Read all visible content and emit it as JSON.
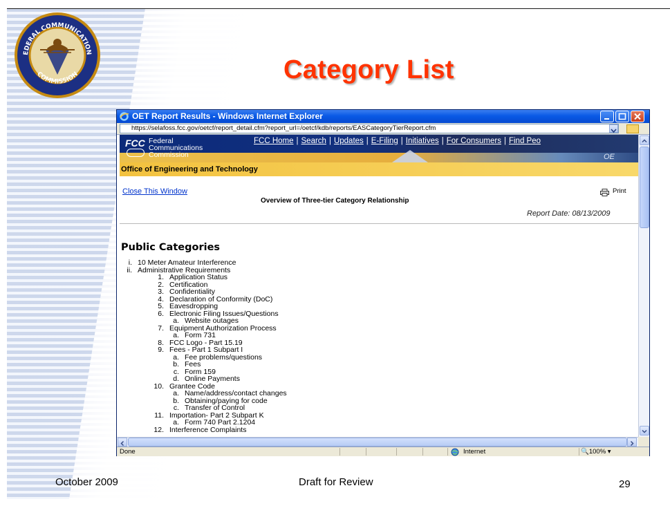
{
  "slide": {
    "title": "Category List",
    "footer_date": "October 2009",
    "footer_draft": "Draft for Review",
    "page_number": "29",
    "seal_text_top": "FEDERAL COMMUNICATIONS",
    "seal_text_bottom": "COMMISSION"
  },
  "browser": {
    "window_title": "OET Report Results - Windows Internet Explorer",
    "url": "https://selafoss.fcc.gov/oetcf/report_detail.cfm?report_url=/oetcf/kdb/reports/EASCategoryTierReport.cfm",
    "status_text": "Done",
    "zone_label": "Internet",
    "zoom_label": "100%"
  },
  "fcc_header": {
    "logo_text": "FCC",
    "org_name_line1": "Federal",
    "org_name_line2": "Communications",
    "org_name_line3": "Commission",
    "nav": [
      "FCC Home",
      "Search",
      "Updates",
      "E-Filing",
      "Initiatives",
      "For Consumers",
      "Find Peo"
    ],
    "office_name": "Office of Engineering and Technology",
    "oe_mark": "OE"
  },
  "report": {
    "close_link": "Close This Window",
    "print_label": "Print",
    "title": "Overview of Three-tier Category Relationship",
    "date_label": "Report Date: 08/13/2009",
    "section_heading": "Public Categories"
  },
  "categories": [
    {
      "level": 1,
      "num": "i.",
      "text": "10 Meter Amateur Interference"
    },
    {
      "level": 1,
      "num": "ii.",
      "text": "Administrative Requirements"
    },
    {
      "level": 2,
      "num": "1.",
      "text": "Application Status"
    },
    {
      "level": 2,
      "num": "2.",
      "text": "Certification"
    },
    {
      "level": 2,
      "num": "3.",
      "text": "Confidentiality"
    },
    {
      "level": 2,
      "num": "4.",
      "text": "Declaration of Conformity (DoC)"
    },
    {
      "level": 2,
      "num": "5.",
      "text": "Eavesdropping"
    },
    {
      "level": 2,
      "num": "6.",
      "text": "Electronic Filing Issues/Questions"
    },
    {
      "level": 3,
      "num": "a.",
      "text": "Website outages"
    },
    {
      "level": 2,
      "num": "7.",
      "text": "Equipment Authorization Process"
    },
    {
      "level": 3,
      "num": "a.",
      "text": "Form 731"
    },
    {
      "level": 2,
      "num": "8.",
      "text": "FCC Logo - Part 15.19"
    },
    {
      "level": 2,
      "num": "9.",
      "text": "Fees - Part 1 Subpart I"
    },
    {
      "level": 3,
      "num": "a.",
      "text": "Fee problems/questions"
    },
    {
      "level": 3,
      "num": "b.",
      "text": "Fees"
    },
    {
      "level": 3,
      "num": "c.",
      "text": "Form 159"
    },
    {
      "level": 3,
      "num": "d.",
      "text": "Online Payments"
    },
    {
      "level": 2,
      "num": "10.",
      "text": "Grantee Code"
    },
    {
      "level": 3,
      "num": "a.",
      "text": "Name/address/contact changes"
    },
    {
      "level": 3,
      "num": "b.",
      "text": "Obtaining/paying for code"
    },
    {
      "level": 3,
      "num": "c.",
      "text": "Transfer of Control"
    },
    {
      "level": 2,
      "num": "11.",
      "text": "Importation- Part 2 Subpart K"
    },
    {
      "level": 3,
      "num": "a.",
      "text": "Form 740 Part 2.1204"
    },
    {
      "level": 2,
      "num": "12.",
      "text": "Interference Complaints"
    }
  ],
  "colors": {
    "title": "#ff3300",
    "link": "#0033cc",
    "office_bar": "#f3c23f",
    "ie_titlebar": "#0a5ae6"
  }
}
